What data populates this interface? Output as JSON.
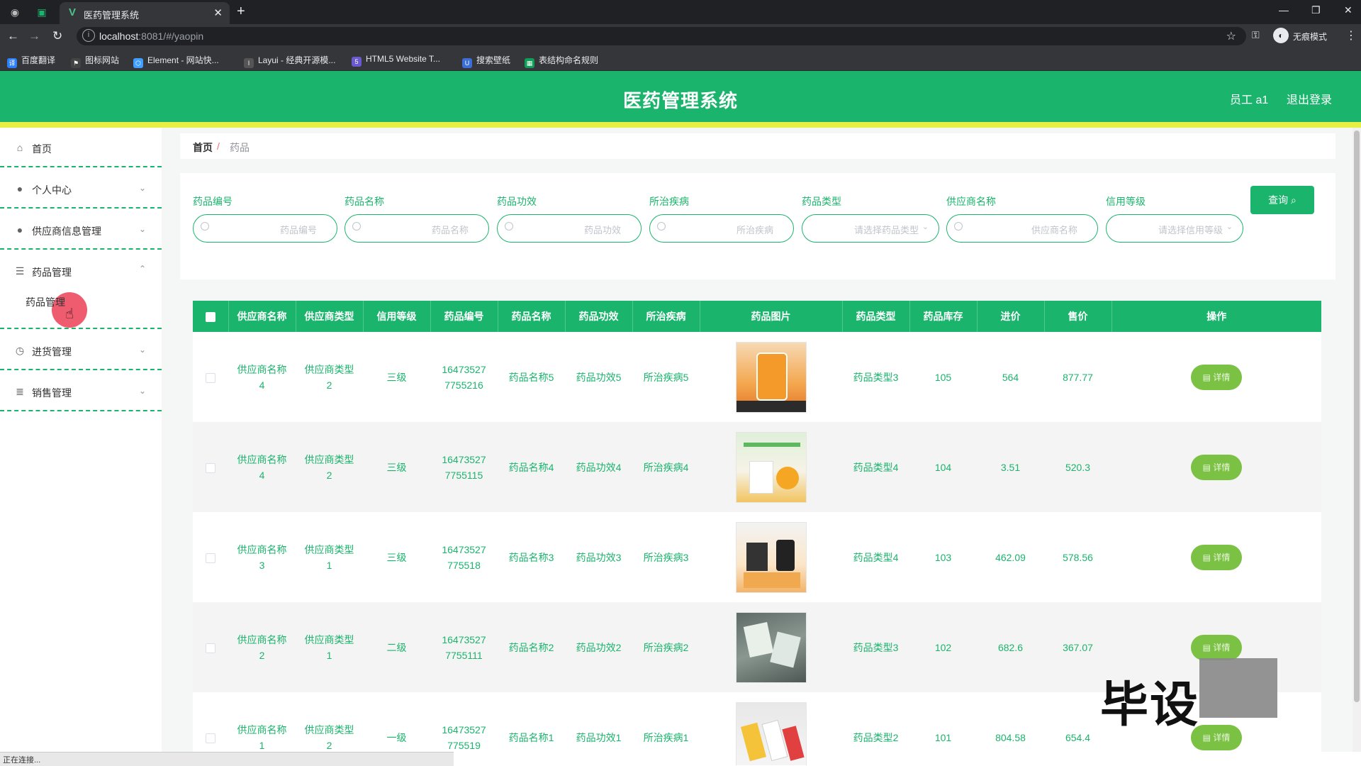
{
  "browser": {
    "tab_title": "医药管理系统",
    "url_host": "localhost",
    "url_rest": ":8081/#/yaopin",
    "incognito_label": "无痕模式",
    "bookmarks": [
      "百度翻译",
      "图标网站",
      "Element - 网站快...",
      "Layui - 经典开源模...",
      "HTML5 Website T...",
      "搜索壁纸",
      "表结构命名规则"
    ],
    "status_text": "正在连接..."
  },
  "header": {
    "title": "医药管理系统",
    "user": "员工 a1",
    "logout": "退出登录"
  },
  "sidebar": {
    "items": [
      {
        "label": "首页",
        "icon": "home-icon"
      },
      {
        "label": "个人中心",
        "icon": "user-icon"
      },
      {
        "label": "供应商信息管理",
        "icon": "user-icon"
      },
      {
        "label": "药品管理",
        "icon": "list-icon"
      },
      {
        "label": "进货管理",
        "icon": "clock-icon"
      },
      {
        "label": "销售管理",
        "icon": "stack-icon"
      }
    ],
    "submenu": "药品管理"
  },
  "breadcrumb": {
    "home": "首页",
    "sep": "/",
    "current": "药品"
  },
  "search": {
    "fields": [
      {
        "label": "药品编号",
        "placeholder": "药品编号"
      },
      {
        "label": "药品名称",
        "placeholder": "药品名称"
      },
      {
        "label": "药品功效",
        "placeholder": "药品功效"
      },
      {
        "label": "所治疾病",
        "placeholder": "所治疾病"
      },
      {
        "label": "药品类型",
        "placeholder": "请选择药品类型"
      },
      {
        "label": "供应商名称",
        "placeholder": "供应商名称"
      },
      {
        "label": "信用等级",
        "placeholder": "请选择信用等级"
      }
    ],
    "query_label": "查询"
  },
  "table": {
    "headers": [
      "供应商名称",
      "供应商类型",
      "信用等级",
      "药品编号",
      "药品名称",
      "药品功效",
      "所治疾病",
      "药品图片",
      "药品类型",
      "药品库存",
      "进价",
      "售价",
      "操作"
    ],
    "detail_label": "详情",
    "rows": [
      {
        "supplier": [
          "供应商名称",
          "4"
        ],
        "supplier_type": [
          "供应商类型",
          "2"
        ],
        "credit": "三级",
        "code": [
          "16473527",
          "7755216"
        ],
        "name": "药品名称5",
        "effect": "药品功效5",
        "disease": "所治疾病5",
        "type": "药品类型3",
        "stock": "105",
        "cost": "564",
        "price": "877.77"
      },
      {
        "supplier": [
          "供应商名称",
          "4"
        ],
        "supplier_type": [
          "供应商类型",
          "2"
        ],
        "credit": "三级",
        "code": [
          "16473527",
          "7755115"
        ],
        "name": "药品名称4",
        "effect": "药品功效4",
        "disease": "所治疾病4",
        "type": "药品类型4",
        "stock": "104",
        "cost": "3.51",
        "price": "520.3"
      },
      {
        "supplier": [
          "供应商名称",
          "3"
        ],
        "supplier_type": [
          "供应商类型",
          "1"
        ],
        "credit": "三级",
        "code": [
          "16473527",
          "775518"
        ],
        "name": "药品名称3",
        "effect": "药品功效3",
        "disease": "所治疾病3",
        "type": "药品类型4",
        "stock": "103",
        "cost": "462.09",
        "price": "578.56"
      },
      {
        "supplier": [
          "供应商名称",
          "2"
        ],
        "supplier_type": [
          "供应商类型",
          "1"
        ],
        "credit": "二级",
        "code": [
          "16473527",
          "7755111"
        ],
        "name": "药品名称2",
        "effect": "药品功效2",
        "disease": "所治疾病2",
        "type": "药品类型3",
        "stock": "102",
        "cost": "682.6",
        "price": "367.07"
      },
      {
        "supplier": [
          "供应商名称",
          "1"
        ],
        "supplier_type": [
          "供应商类型",
          "2"
        ],
        "credit": "一级",
        "code": [
          "16473527",
          "775519"
        ],
        "name": "药品名称1",
        "effect": "药品功效1",
        "disease": "所治疾病1",
        "type": "药品类型2",
        "stock": "101",
        "cost": "804.58",
        "price": "654.4"
      }
    ]
  },
  "watermark": "毕设",
  "colors": {
    "primary": "#1bb46c",
    "accent_strip": "#e7ef45",
    "detail_button": "#7bc143"
  }
}
